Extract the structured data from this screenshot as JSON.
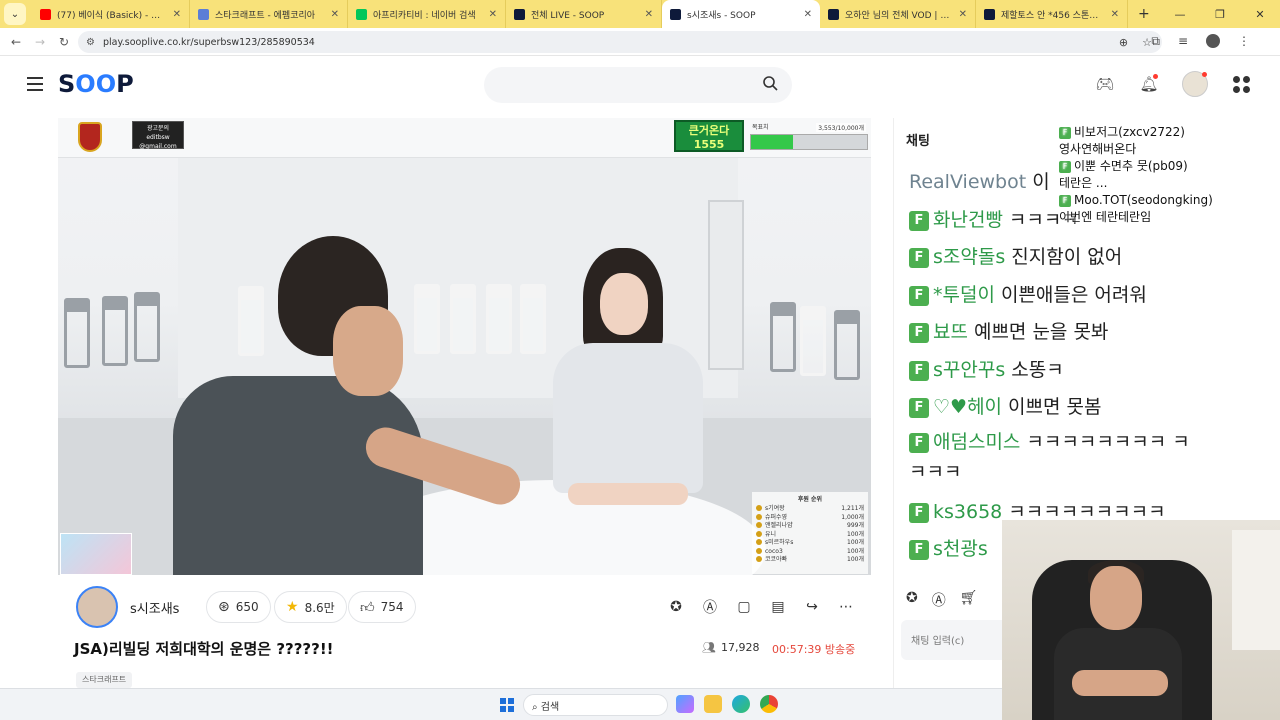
{
  "browser": {
    "tabs": [
      {
        "title": "(77) 베이식 (Basick) - 만남은",
        "color": "#ff0000",
        "active": false
      },
      {
        "title": "스타크래프트 - 에펨코리아",
        "color": "#5b7ed6",
        "active": false
      },
      {
        "title": "아프리카티비 : 네이버 검색",
        "color": "#03c75a",
        "active": false
      },
      {
        "title": "전체 LIVE - SOOP",
        "color": "#0e1a3a",
        "active": false
      },
      {
        "title": "s시조새s - SOOP",
        "color": "#0e1a3a",
        "active": true
      },
      {
        "title": "오하안 님의 전체 VOD | SOOP",
        "color": "#0e1a3a",
        "active": false
      },
      {
        "title": "제할토스 안 *456 스톤활영",
        "color": "#0e1a3a",
        "active": false
      }
    ],
    "url": "play.sooplive.co.kr/superbsw123/285890534"
  },
  "header": {
    "logo": "SOOP",
    "search_placeholder": ""
  },
  "video_overlay": {
    "email_text": "광고문의\neditbsw\n@gmail.com",
    "badge_text": "큰거온다\n1555",
    "gauge_label": "목표치",
    "gauge_value": "3,553/10,000개",
    "gauge_fraction": 0.36,
    "rank_title": "후원 순위",
    "rank_rows": [
      {
        "name": "s기여왕",
        "value": "1,211개"
      },
      {
        "name": "슈퍼수영",
        "value": "1,000개"
      },
      {
        "name": "앤젤리나얌",
        "value": "999개"
      },
      {
        "name": "유니",
        "value": "100개"
      },
      {
        "name": "s미르하우s",
        "value": "100개"
      },
      {
        "name": "coco3",
        "value": "100개"
      },
      {
        "name": "코코아빠",
        "value": "100개"
      }
    ]
  },
  "channel": {
    "name": "s시조새s",
    "stats": [
      {
        "icon": "bookmark-icon",
        "value": "650"
      },
      {
        "icon": "star-icon",
        "value": "8.6만"
      },
      {
        "icon": "thumbs-up-icon",
        "value": "754"
      }
    ]
  },
  "stream": {
    "title": "JSA)리빌딩 저희대학의 운명은 ?????!!",
    "viewers": "17,928",
    "elapsed": "00:57:39 방송중",
    "tag": "스타크래프트"
  },
  "chat": {
    "header": "채팅",
    "messages": [
      {
        "nick": "RealViewbot",
        "text": "이",
        "badge": false,
        "bot": true
      },
      {
        "nick": "화난건빵",
        "text": "ㅋㅋㅋㅋ",
        "badge": true
      },
      {
        "nick": "s조약돌s",
        "text": "진지함이 없어",
        "badge": true
      },
      {
        "nick": "*투덜이",
        "text": "이쁜애들은 어려워",
        "badge": true
      },
      {
        "nick": "뵤뜨",
        "text": "예쁘면 눈을 못봐",
        "badge": true
      },
      {
        "nick": "s꾸안꾸s",
        "text": "소똥ㅋ",
        "badge": true
      },
      {
        "nick": "♡♥헤이",
        "text": "이쁘면 못봄",
        "badge": true
      },
      {
        "nick": "애덤스미스",
        "text": "ㅋㅋㅋㅋㅋㅋㅋㅋ ㅋㅋㅋㅋ",
        "badge": true,
        "wrap": true
      },
      {
        "nick": "ks3658",
        "text": "ㅋㅋㅋㅋㅋㅋㅋㅋㅋ",
        "badge": true
      },
      {
        "nick": "s천광s",
        "text": "",
        "badge": true
      }
    ],
    "floating": [
      {
        "text": "비보저그(zxcv2722)",
        "badge": true
      },
      {
        "text": "영사연해버온다",
        "badge": false
      },
      {
        "text": "이뿐 수면추 뭇(pb09)",
        "badge": true
      },
      {
        "text": "테란은 ...",
        "badge": false
      },
      {
        "text": "Moo.TOT(seodongking)",
        "badge": true
      },
      {
        "text": "이번엔 테란테란임",
        "badge": false
      }
    ],
    "input_placeholder": "채팅 입력(c)"
  },
  "taskbar": {
    "search_label": "검색"
  }
}
